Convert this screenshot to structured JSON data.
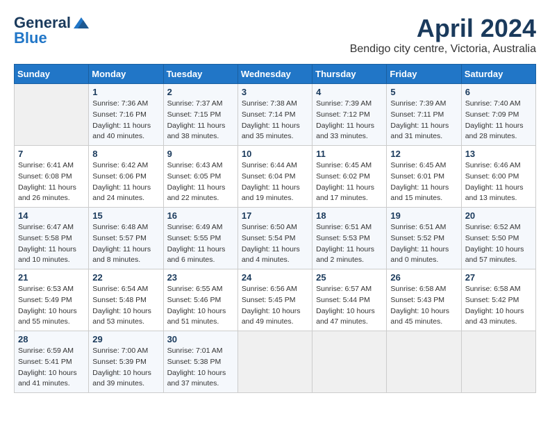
{
  "logo": {
    "line1": "General",
    "line2": "Blue"
  },
  "title": "April 2024",
  "location": "Bendigo city centre, Victoria, Australia",
  "days_of_week": [
    "Sunday",
    "Monday",
    "Tuesday",
    "Wednesday",
    "Thursday",
    "Friday",
    "Saturday"
  ],
  "weeks": [
    [
      {
        "day": "",
        "info": ""
      },
      {
        "day": "1",
        "info": "Sunrise: 7:36 AM\nSunset: 7:16 PM\nDaylight: 11 hours\nand 40 minutes."
      },
      {
        "day": "2",
        "info": "Sunrise: 7:37 AM\nSunset: 7:15 PM\nDaylight: 11 hours\nand 38 minutes."
      },
      {
        "day": "3",
        "info": "Sunrise: 7:38 AM\nSunset: 7:14 PM\nDaylight: 11 hours\nand 35 minutes."
      },
      {
        "day": "4",
        "info": "Sunrise: 7:39 AM\nSunset: 7:12 PM\nDaylight: 11 hours\nand 33 minutes."
      },
      {
        "day": "5",
        "info": "Sunrise: 7:39 AM\nSunset: 7:11 PM\nDaylight: 11 hours\nand 31 minutes."
      },
      {
        "day": "6",
        "info": "Sunrise: 7:40 AM\nSunset: 7:09 PM\nDaylight: 11 hours\nand 28 minutes."
      }
    ],
    [
      {
        "day": "7",
        "info": "Sunrise: 6:41 AM\nSunset: 6:08 PM\nDaylight: 11 hours\nand 26 minutes."
      },
      {
        "day": "8",
        "info": "Sunrise: 6:42 AM\nSunset: 6:06 PM\nDaylight: 11 hours\nand 24 minutes."
      },
      {
        "day": "9",
        "info": "Sunrise: 6:43 AM\nSunset: 6:05 PM\nDaylight: 11 hours\nand 22 minutes."
      },
      {
        "day": "10",
        "info": "Sunrise: 6:44 AM\nSunset: 6:04 PM\nDaylight: 11 hours\nand 19 minutes."
      },
      {
        "day": "11",
        "info": "Sunrise: 6:45 AM\nSunset: 6:02 PM\nDaylight: 11 hours\nand 17 minutes."
      },
      {
        "day": "12",
        "info": "Sunrise: 6:45 AM\nSunset: 6:01 PM\nDaylight: 11 hours\nand 15 minutes."
      },
      {
        "day": "13",
        "info": "Sunrise: 6:46 AM\nSunset: 6:00 PM\nDaylight: 11 hours\nand 13 minutes."
      }
    ],
    [
      {
        "day": "14",
        "info": "Sunrise: 6:47 AM\nSunset: 5:58 PM\nDaylight: 11 hours\nand 10 minutes."
      },
      {
        "day": "15",
        "info": "Sunrise: 6:48 AM\nSunset: 5:57 PM\nDaylight: 11 hours\nand 8 minutes."
      },
      {
        "day": "16",
        "info": "Sunrise: 6:49 AM\nSunset: 5:55 PM\nDaylight: 11 hours\nand 6 minutes."
      },
      {
        "day": "17",
        "info": "Sunrise: 6:50 AM\nSunset: 5:54 PM\nDaylight: 11 hours\nand 4 minutes."
      },
      {
        "day": "18",
        "info": "Sunrise: 6:51 AM\nSunset: 5:53 PM\nDaylight: 11 hours\nand 2 minutes."
      },
      {
        "day": "19",
        "info": "Sunrise: 6:51 AM\nSunset: 5:52 PM\nDaylight: 11 hours\nand 0 minutes."
      },
      {
        "day": "20",
        "info": "Sunrise: 6:52 AM\nSunset: 5:50 PM\nDaylight: 10 hours\nand 57 minutes."
      }
    ],
    [
      {
        "day": "21",
        "info": "Sunrise: 6:53 AM\nSunset: 5:49 PM\nDaylight: 10 hours\nand 55 minutes."
      },
      {
        "day": "22",
        "info": "Sunrise: 6:54 AM\nSunset: 5:48 PM\nDaylight: 10 hours\nand 53 minutes."
      },
      {
        "day": "23",
        "info": "Sunrise: 6:55 AM\nSunset: 5:46 PM\nDaylight: 10 hours\nand 51 minutes."
      },
      {
        "day": "24",
        "info": "Sunrise: 6:56 AM\nSunset: 5:45 PM\nDaylight: 10 hours\nand 49 minutes."
      },
      {
        "day": "25",
        "info": "Sunrise: 6:57 AM\nSunset: 5:44 PM\nDaylight: 10 hours\nand 47 minutes."
      },
      {
        "day": "26",
        "info": "Sunrise: 6:58 AM\nSunset: 5:43 PM\nDaylight: 10 hours\nand 45 minutes."
      },
      {
        "day": "27",
        "info": "Sunrise: 6:58 AM\nSunset: 5:42 PM\nDaylight: 10 hours\nand 43 minutes."
      }
    ],
    [
      {
        "day": "28",
        "info": "Sunrise: 6:59 AM\nSunset: 5:41 PM\nDaylight: 10 hours\nand 41 minutes."
      },
      {
        "day": "29",
        "info": "Sunrise: 7:00 AM\nSunset: 5:39 PM\nDaylight: 10 hours\nand 39 minutes."
      },
      {
        "day": "30",
        "info": "Sunrise: 7:01 AM\nSunset: 5:38 PM\nDaylight: 10 hours\nand 37 minutes."
      },
      {
        "day": "",
        "info": ""
      },
      {
        "day": "",
        "info": ""
      },
      {
        "day": "",
        "info": ""
      },
      {
        "day": "",
        "info": ""
      }
    ]
  ]
}
